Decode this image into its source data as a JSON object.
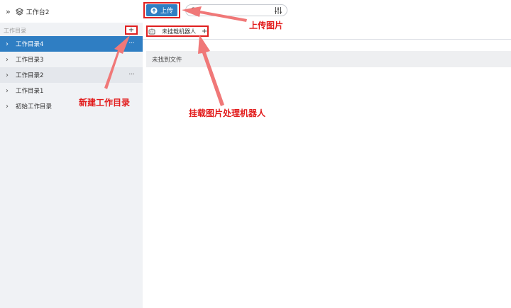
{
  "workspace": {
    "title": "工作台2",
    "expand_icon": "double-chevron-right-icon",
    "workspace_icon": "layers-icon"
  },
  "sidebar": {
    "section_label": "工作目录",
    "add_label": "+",
    "items": [
      {
        "label": "工作目录4",
        "more": "...",
        "state": "active"
      },
      {
        "label": "工作目录3",
        "more": "",
        "state": "normal"
      },
      {
        "label": "工作目录2",
        "more": "...",
        "state": "hover"
      },
      {
        "label": "工作目录1",
        "more": "",
        "state": "normal"
      },
      {
        "label": "初始工作目录",
        "more": "",
        "state": "normal"
      }
    ]
  },
  "toolbar": {
    "upload_label": "上传",
    "search_placeholder": ""
  },
  "tabs": {
    "robot_label": "未挂载机器人",
    "add_label": "+"
  },
  "main": {
    "empty_text": "未找到文件"
  },
  "annotations": {
    "upload": "上传图片",
    "new_dir": "新建工作目录",
    "robot": "挂载图片处理机器人"
  },
  "colors": {
    "accent": "#2f7ec3",
    "annotation": "#e02020",
    "arrow": "#f07878"
  }
}
